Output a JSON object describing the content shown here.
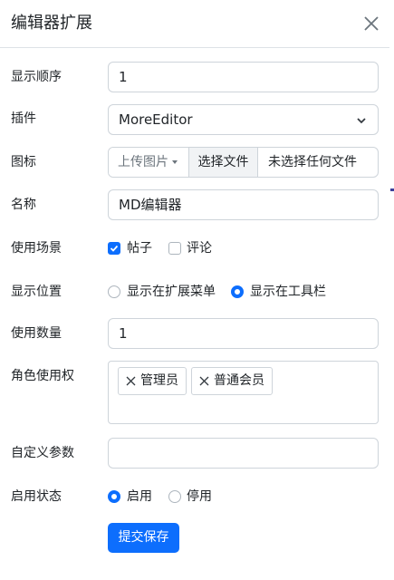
{
  "modal": {
    "title": "编辑器扩展",
    "close_label": "×"
  },
  "form": {
    "display_order": {
      "label": "显示顺序",
      "value": "1"
    },
    "plugin": {
      "label": "插件",
      "value": "MoreEditor"
    },
    "icon": {
      "label": "图标",
      "upload_button": "上传图片",
      "choose_file": "选择文件",
      "file_status": "未选择任何文件"
    },
    "name": {
      "label": "名称",
      "value": "MD编辑器"
    },
    "usage_scene": {
      "label": "使用场景",
      "options": [
        {
          "label": "帖子",
          "checked": true
        },
        {
          "label": "评论",
          "checked": false
        }
      ]
    },
    "display_position": {
      "label": "显示位置",
      "options": [
        {
          "label": "显示在扩展菜单",
          "selected": false
        },
        {
          "label": "显示在工具栏",
          "selected": true
        }
      ]
    },
    "usage_count": {
      "label": "使用数量",
      "value": "1"
    },
    "role_permission": {
      "label": "角色使用权",
      "tags": [
        "管理员",
        "普通会员"
      ]
    },
    "custom_params": {
      "label": "自定义参数",
      "value": ""
    },
    "status": {
      "label": "启用状态",
      "options": [
        {
          "label": "启用",
          "selected": true
        },
        {
          "label": "停用",
          "selected": false
        }
      ]
    },
    "submit_label": "提交保存"
  },
  "colors": {
    "primary": "#0d6efd",
    "border": "#ced4da",
    "text": "#212529",
    "muted": "#6c757d"
  }
}
